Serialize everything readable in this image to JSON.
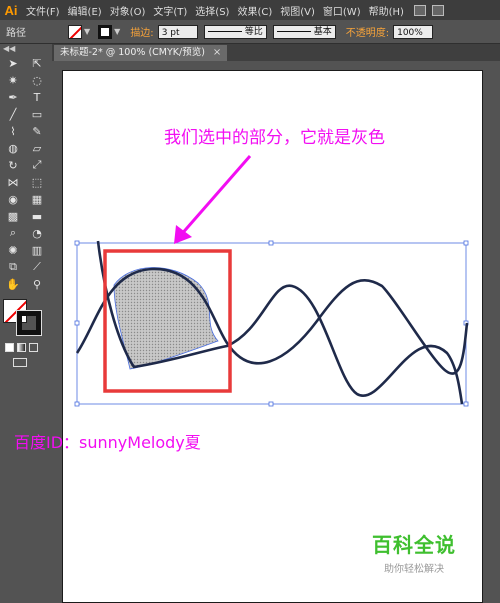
{
  "app": {
    "logo": "Ai"
  },
  "menu": [
    "文件(F)",
    "编辑(E)",
    "对象(O)",
    "文字(T)",
    "选择(S)",
    "效果(C)",
    "视图(V)",
    "窗口(W)",
    "帮助(H)"
  ],
  "control_bar": {
    "object_type": "路径",
    "stroke_label": "描边:",
    "stroke_value": "3 pt",
    "stroke_profile": "等比",
    "brush": "基本",
    "opacity_label": "不透明度:",
    "opacity_value": "100%"
  },
  "document_tab": {
    "title": "未标题-2* @ 100% (CMYK/预览)",
    "close": "×"
  },
  "canvas": {
    "annotation": "我们选中的部分，它就是灰色",
    "watermark": "百度ID：sunnyMelody夏",
    "brand_title": "百科全说",
    "brand_subtitle": "助你轻松解决"
  },
  "colors": {
    "accent_magenta": "#f20df2",
    "highlight_red": "#e83a3a",
    "path_navy": "#1f2a4a",
    "selection_blue": "#4a6ee0",
    "brand_green": "#3fbf2f",
    "label_orange": "#f7a33a"
  },
  "tools": [
    "selection-tool",
    "direct-selection-tool",
    "magic-wand-tool",
    "lasso-tool",
    "pen-tool",
    "type-tool",
    "line-tool",
    "rectangle-tool",
    "paintbrush-tool",
    "pencil-tool",
    "blob-brush-tool",
    "eraser-tool",
    "rotate-tool",
    "scale-tool",
    "width-tool",
    "free-transform-tool",
    "shape-builder-tool",
    "perspective-tool",
    "mesh-tool",
    "gradient-tool",
    "eyedropper-tool",
    "blend-tool",
    "symbol-sprayer-tool",
    "column-graph-tool",
    "artboard-tool",
    "slice-tool",
    "hand-tool",
    "zoom-tool"
  ]
}
